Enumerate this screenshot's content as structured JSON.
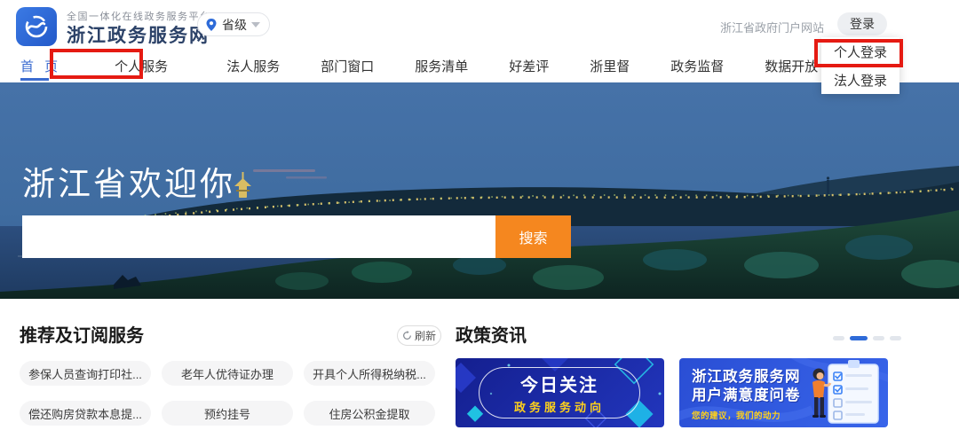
{
  "header": {
    "tagline": "全国一体化在线政务服务平台",
    "site_name": "浙江政务服务网",
    "region_selector": "省级",
    "portal_link": "浙江省政府门户网站",
    "login_button": "登录"
  },
  "login_menu": {
    "items": [
      {
        "label": "个人登录"
      },
      {
        "label": "法人登录"
      }
    ]
  },
  "nav": {
    "items": [
      {
        "label": "首 页",
        "active": true
      },
      {
        "label": "个人服务",
        "active": false
      },
      {
        "label": "法人服务",
        "active": false
      },
      {
        "label": "部门窗口",
        "active": false
      },
      {
        "label": "服务清单",
        "active": false
      },
      {
        "label": "好差评",
        "active": false
      },
      {
        "label": "浙里督",
        "active": false
      },
      {
        "label": "政务监督",
        "active": false
      },
      {
        "label": "数据开放",
        "active": false
      }
    ]
  },
  "hero": {
    "title": "浙江省欢迎你",
    "search_value": "",
    "search_placeholder": "",
    "search_button": "搜索"
  },
  "recommend": {
    "title": "推荐及订阅服务",
    "refresh_label": "刷新",
    "services": [
      "参保人员查询打印社...",
      "老年人优待证办理",
      "开具个人所得税纳税...",
      "偿还购房贷款本息提...",
      "预约挂号",
      "住房公积金提取"
    ]
  },
  "news": {
    "title": "政策资讯",
    "carousel": {
      "dot_count": 4,
      "active_index": 1
    },
    "banners": [
      {
        "line1": "今日关注",
        "line2": "政务服务动向"
      },
      {
        "line1": "浙江政务服务网",
        "line2": "用户满意度问卷",
        "line3": "您的建议，我们的动力"
      }
    ]
  },
  "colors": {
    "accent_blue": "#2f6bd8",
    "search_orange": "#f5871f",
    "annotation_red": "#e51a12",
    "site_title_navy": "#2c4268",
    "promo1_bg": "#1b2d9b",
    "promo2_bg": "#2f55d8",
    "promo_gold": "#ffd11a"
  }
}
